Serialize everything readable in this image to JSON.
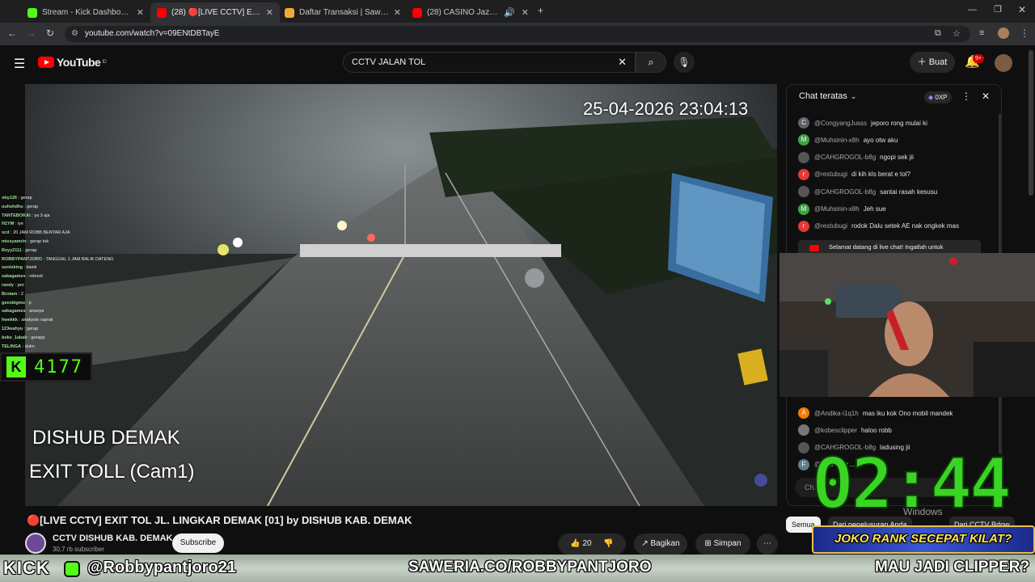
{
  "browser": {
    "tabs": [
      {
        "title": "Stream - Kick Dashboard",
        "color": "#53fc18"
      },
      {
        "title": "(28) 🔴[LIVE CCTV] EXIT TOL JL",
        "color": "#ff0000"
      },
      {
        "title": "Daftar Transaksi | Saweria",
        "color": "#f3a83b"
      },
      {
        "title": "(28) CASINO Jazz Music 🎰",
        "color": "#ff0000"
      }
    ],
    "url": "youtube.com/watch?v=09ENtDBTayE"
  },
  "youtube": {
    "logo": "YouTube",
    "country": "ID",
    "search_value": "CCTV JALAN TOL",
    "create_label": "Buat",
    "notif_count": "9+"
  },
  "video": {
    "timestamp": "25-04-2026 23:04:13",
    "overlay_line1": "DISHUB DEMAK",
    "overlay_line2": "EXIT TOLL",
    "overlay_cam": "(Cam1)",
    "title": "🔴[LIVE CCTV] EXIT TOL JL. LINGKAR DEMAK [01] by DISHUB KAB. DEMAK",
    "channel": "CCTV DISHUB KAB. DEMAK",
    "subs": "30,7 rb subscriber",
    "subscribe_label": "Subscribe",
    "likes": "20",
    "share_label": "Bagikan",
    "save_label": "Simpan"
  },
  "chat": {
    "header": "Chat teratas",
    "points": "0XP",
    "messages": [
      {
        "user": "@CongyangJusss",
        "text": "jeporo rong mulai ki",
        "letter": "C",
        "color": "#5f6368"
      },
      {
        "user": "@Muhsinin-x8h",
        "text": "ayo otw aku",
        "letter": "M",
        "color": "#43a047"
      },
      {
        "user": "@CAHGROGOL-b8g",
        "text": "ngopi sek jii",
        "letter": "",
        "color": "#555"
      },
      {
        "user": "@restubugi",
        "text": "di kih kls berat e tol?",
        "letter": "r",
        "color": "#e53935"
      },
      {
        "user": "@CAHGROGOL-b8g",
        "text": "santai rasah kesusu",
        "letter": "",
        "color": "#555"
      },
      {
        "user": "@Muhsinin-x8h",
        "text": "Jeh sue",
        "letter": "M",
        "color": "#43a047"
      },
      {
        "user": "@restubugi",
        "text": "rodok Dalu setek AE nak ongkek mas",
        "letter": "r",
        "color": "#e53935"
      }
    ],
    "welcome": "Selamat datang di live chat! Ingatlah untuk",
    "messages_lower": [
      {
        "user": "@Andika-i1q1h",
        "text": "mas iku kok Ono mobil mandek",
        "letter": "A",
        "color": "#f57c00"
      },
      {
        "user": "@kobesclipper",
        "text": "haloo robb",
        "letter": "",
        "color": "#777"
      },
      {
        "user": "@CAHGROGOL-b8g",
        "text": "ladusing jii",
        "letter": "",
        "color": "#555"
      },
      {
        "user": "@...16",
        "text": "oby ...",
        "letter": "F",
        "color": "#607d8b"
      }
    ],
    "input_placeholder": "Ch..."
  },
  "stream_overlay": {
    "viewer_count": "4177",
    "timer": "02:44",
    "windows_text": "Windows",
    "semua_label": "Semua",
    "filter_text": "Dari penelusuran Anda",
    "filter_text2": "Dari CCTV Bdow",
    "banner": "JOKO RANK SECEPAT KILAT?",
    "kick_logo": "KICK",
    "kick_handle": "@Robbypantjoro21",
    "saweria": "SAWERIA.CO/ROBBYPANTJORO",
    "clipper": "MAU JADI CLIPPER?",
    "side_chat": [
      {
        "user": "oby126",
        "msg": "gerap"
      },
      {
        "user": "uuhshdhu",
        "msg": "gerap"
      },
      {
        "user": "TANTEBOKAI",
        "msg": "ya 3 aja"
      },
      {
        "user": "H1YM",
        "msg": "iye"
      },
      {
        "user": "xcd",
        "msg": "20 JAM ROBB BENTAR AJA"
      },
      {
        "user": "missyamrin",
        "msg": "gerap tok"
      },
      {
        "user": "Reyy2111",
        "msg": "gerap"
      },
      {
        "user": "ROBBYPANTJORO",
        "msg": "TANGGAL 1 JAM BALIK DATENG"
      },
      {
        "user": "suntsking",
        "msg": "bwek"
      },
      {
        "user": "sakagames",
        "msg": "rebook"
      },
      {
        "user": "randy",
        "msg": "jwo"
      },
      {
        "user": "Brotam",
        "msg": "2"
      },
      {
        "user": "geesbigmo",
        "msg": "p"
      },
      {
        "user": "sakagames",
        "msg": "ananya"
      },
      {
        "user": "hwekkk",
        "msg": "anakyolo raprak"
      },
      {
        "user": "123wahyu",
        "msg": "gerap"
      },
      {
        "user": "boke_1abah",
        "msg": "gerapp"
      },
      {
        "user": "TELINGA",
        "msg": "dukn"
      }
    ]
  }
}
